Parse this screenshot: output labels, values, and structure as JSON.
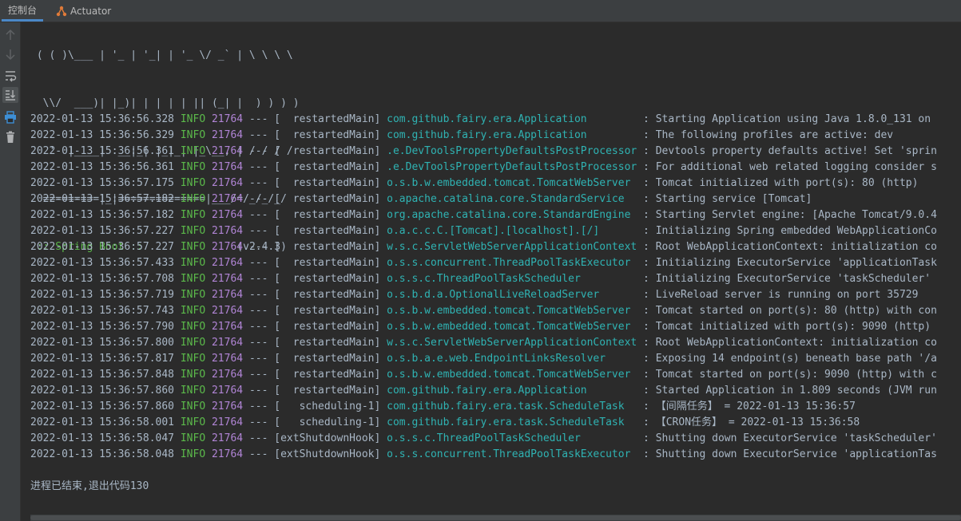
{
  "tabs": [
    {
      "label": "控制台",
      "icon": "console-tab",
      "active": true
    },
    {
      "label": "Actuator",
      "icon": "actuator-icon",
      "active": false
    }
  ],
  "toolbar": {
    "buttons": [
      {
        "icon": "arrow-up-icon",
        "enabled": false
      },
      {
        "icon": "arrow-down-icon",
        "enabled": false
      },
      {
        "icon": "soft-wrap-icon",
        "enabled": true
      },
      {
        "icon": "scroll-to-end-icon",
        "enabled": true
      },
      {
        "icon": "print-icon",
        "enabled": true
      },
      {
        "icon": "trash-icon",
        "enabled": true
      }
    ]
  },
  "banner": {
    "lines": [
      " ( ( )\\___ | '_ | '_| | '_ \\/ _` | \\ \\ \\ \\",
      "  \\\\/  ___)| |_)| | | | | || (_| |  ) ) ) )",
      "   '  |____| .__|_| |_|_| |_\\__, | / / / /",
      "  =========|_|==============|___/=/_/_/_/"
    ],
    "label": " :: Spring Boot ::",
    "version": "               (v2.4.3)"
  },
  "log_rows": [
    {
      "ts": "2022-01-13 15:36:56.328",
      "level": " INFO",
      "pid": " 21764",
      "sep": " --- ",
      "thread": "[  restartedMain]",
      "logger": " com.github.fairy.era.Application        ",
      "msg": " : Starting Application using Java 1.8.0_131 on"
    },
    {
      "ts": "2022-01-13 15:36:56.329",
      "level": " INFO",
      "pid": " 21764",
      "sep": " --- ",
      "thread": "[  restartedMain]",
      "logger": " com.github.fairy.era.Application        ",
      "msg": " : The following profiles are active: dev"
    },
    {
      "ts": "2022-01-13 15:36:56.361",
      "level": " INFO",
      "pid": " 21764",
      "sep": " --- ",
      "thread": "[  restartedMain]",
      "logger": " .e.DevToolsPropertyDefaultsPostProcessor",
      "msg": " : Devtools property defaults active! Set 'sprin"
    },
    {
      "ts": "2022-01-13 15:36:56.361",
      "level": " INFO",
      "pid": " 21764",
      "sep": " --- ",
      "thread": "[  restartedMain]",
      "logger": " .e.DevToolsPropertyDefaultsPostProcessor",
      "msg": " : For additional web related logging consider s"
    },
    {
      "ts": "2022-01-13 15:36:57.175",
      "level": " INFO",
      "pid": " 21764",
      "sep": " --- ",
      "thread": "[  restartedMain]",
      "logger": " o.s.b.w.embedded.tomcat.TomcatWebServer ",
      "msg": " : Tomcat initialized with port(s): 80 (http)"
    },
    {
      "ts": "2022-01-13 15:36:57.182",
      "level": " INFO",
      "pid": " 21764",
      "sep": " --- ",
      "thread": "[  restartedMain]",
      "logger": " o.apache.catalina.core.StandardService  ",
      "msg": " : Starting service [Tomcat]"
    },
    {
      "ts": "2022-01-13 15:36:57.182",
      "level": " INFO",
      "pid": " 21764",
      "sep": " --- ",
      "thread": "[  restartedMain]",
      "logger": " org.apache.catalina.core.StandardEngine ",
      "msg": " : Starting Servlet engine: [Apache Tomcat/9.0.4"
    },
    {
      "ts": "2022-01-13 15:36:57.227",
      "level": " INFO",
      "pid": " 21764",
      "sep": " --- ",
      "thread": "[  restartedMain]",
      "logger": " o.a.c.c.C.[Tomcat].[localhost].[/]      ",
      "msg": " : Initializing Spring embedded WebApplicationCo"
    },
    {
      "ts": "2022-01-13 15:36:57.227",
      "level": " INFO",
      "pid": " 21764",
      "sep": " --- ",
      "thread": "[  restartedMain]",
      "logger": " w.s.c.ServletWebServerApplicationContext",
      "msg": " : Root WebApplicationContext: initialization co"
    },
    {
      "ts": "2022-01-13 15:36:57.433",
      "level": " INFO",
      "pid": " 21764",
      "sep": " --- ",
      "thread": "[  restartedMain]",
      "logger": " o.s.s.concurrent.ThreadPoolTaskExecutor ",
      "msg": " : Initializing ExecutorService 'applicationTask"
    },
    {
      "ts": "2022-01-13 15:36:57.708",
      "level": " INFO",
      "pid": " 21764",
      "sep": " --- ",
      "thread": "[  restartedMain]",
      "logger": " o.s.s.c.ThreadPoolTaskScheduler         ",
      "msg": " : Initializing ExecutorService 'taskScheduler'"
    },
    {
      "ts": "2022-01-13 15:36:57.719",
      "level": " INFO",
      "pid": " 21764",
      "sep": " --- ",
      "thread": "[  restartedMain]",
      "logger": " o.s.b.d.a.OptionalLiveReloadServer      ",
      "msg": " : LiveReload server is running on port 35729"
    },
    {
      "ts": "2022-01-13 15:36:57.743",
      "level": " INFO",
      "pid": " 21764",
      "sep": " --- ",
      "thread": "[  restartedMain]",
      "logger": " o.s.b.w.embedded.tomcat.TomcatWebServer ",
      "msg": " : Tomcat started on port(s): 80 (http) with con"
    },
    {
      "ts": "2022-01-13 15:36:57.790",
      "level": " INFO",
      "pid": " 21764",
      "sep": " --- ",
      "thread": "[  restartedMain]",
      "logger": " o.s.b.w.embedded.tomcat.TomcatWebServer ",
      "msg": " : Tomcat initialized with port(s): 9090 (http)"
    },
    {
      "ts": "2022-01-13 15:36:57.800",
      "level": " INFO",
      "pid": " 21764",
      "sep": " --- ",
      "thread": "[  restartedMain]",
      "logger": " w.s.c.ServletWebServerApplicationContext",
      "msg": " : Root WebApplicationContext: initialization co"
    },
    {
      "ts": "2022-01-13 15:36:57.817",
      "level": " INFO",
      "pid": " 21764",
      "sep": " --- ",
      "thread": "[  restartedMain]",
      "logger": " o.s.b.a.e.web.EndpointLinksResolver     ",
      "msg": " : Exposing 14 endpoint(s) beneath base path '/a"
    },
    {
      "ts": "2022-01-13 15:36:57.848",
      "level": " INFO",
      "pid": " 21764",
      "sep": " --- ",
      "thread": "[  restartedMain]",
      "logger": " o.s.b.w.embedded.tomcat.TomcatWebServer ",
      "msg": " : Tomcat started on port(s): 9090 (http) with c"
    },
    {
      "ts": "2022-01-13 15:36:57.860",
      "level": " INFO",
      "pid": " 21764",
      "sep": " --- ",
      "thread": "[  restartedMain]",
      "logger": " com.github.fairy.era.Application        ",
      "msg": " : Started Application in 1.809 seconds (JVM run"
    },
    {
      "ts": "2022-01-13 15:36:57.860",
      "level": " INFO",
      "pid": " 21764",
      "sep": " --- ",
      "thread": "[   scheduling-1]",
      "logger": " com.github.fairy.era.task.ScheduleTask  ",
      "msg": " : 【间隔任务】 = 2022-01-13 15:36:57"
    },
    {
      "ts": "2022-01-13 15:36:58.001",
      "level": " INFO",
      "pid": " 21764",
      "sep": " --- ",
      "thread": "[   scheduling-1]",
      "logger": " com.github.fairy.era.task.ScheduleTask  ",
      "msg": " : 【CRON任务】 = 2022-01-13 15:36:58"
    },
    {
      "ts": "2022-01-13 15:36:58.047",
      "level": " INFO",
      "pid": " 21764",
      "sep": " --- ",
      "thread": "[extShutdownHook]",
      "logger": " o.s.s.c.ThreadPoolTaskScheduler         ",
      "msg": " : Shutting down ExecutorService 'taskScheduler'"
    },
    {
      "ts": "2022-01-13 15:36:58.048",
      "level": " INFO",
      "pid": " 21764",
      "sep": " --- ",
      "thread": "[extShutdownHook]",
      "logger": " o.s.s.concurrent.ThreadPoolTaskExecutor ",
      "msg": " : Shutting down ExecutorService 'applicationTas"
    }
  ],
  "exit_message": "进程已结束,退出代码130",
  "colors": {
    "background": "#2b2b2b",
    "text": "#a9b7c6",
    "info_level": "#5bb94a",
    "pid": "#b185d6",
    "logger": "#2fb3b3",
    "spring_label": "#5bb94a",
    "active_tab_underline": "#4a88c7"
  }
}
